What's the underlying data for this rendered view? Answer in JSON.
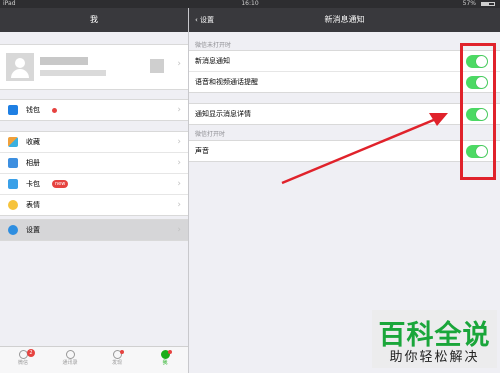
{
  "status": {
    "device": "iPad",
    "time": "16:10",
    "battery": "57%"
  },
  "left": {
    "title": "我",
    "group1": [
      {
        "label": "钱包",
        "icon": "wallet-icon",
        "color": "#1e7fe3"
      }
    ],
    "group2": [
      {
        "label": "收藏",
        "icon": "favorites-icon",
        "color": "#f0a03a"
      },
      {
        "label": "相册",
        "icon": "album-icon",
        "color": "#3d8fe0"
      },
      {
        "label": "卡包",
        "icon": "card-icon",
        "color": "#3aa0e8",
        "badge": "new"
      },
      {
        "label": "表情",
        "icon": "sticker-icon",
        "color": "#f6c33b"
      }
    ],
    "settings": {
      "label": "设置",
      "icon": "gear-icon",
      "color": "#2e8ee0"
    },
    "tabs": [
      {
        "label": "微信",
        "badge": "2"
      },
      {
        "label": "通讯录"
      },
      {
        "label": "发现"
      },
      {
        "label": "我",
        "active": true
      }
    ]
  },
  "right": {
    "back": "设置",
    "title": "新消息通知",
    "section1_header": "微信未打开时",
    "section1_rows": [
      {
        "label": "新消息通知",
        "on": true
      },
      {
        "label": "语音和视频通话提醒",
        "on": true
      }
    ],
    "section2_rows": [
      {
        "label": "通知显示消息详情",
        "on": true
      }
    ],
    "section3_header": "微信打开时",
    "section3_rows": [
      {
        "label": "声音",
        "on": true
      }
    ]
  },
  "watermark": {
    "line1": "百科全说",
    "line2": "助你轻松解决"
  },
  "colors": {
    "accent": "#4cd964",
    "highlight": "#e0222b",
    "navbar": "#39393d"
  }
}
